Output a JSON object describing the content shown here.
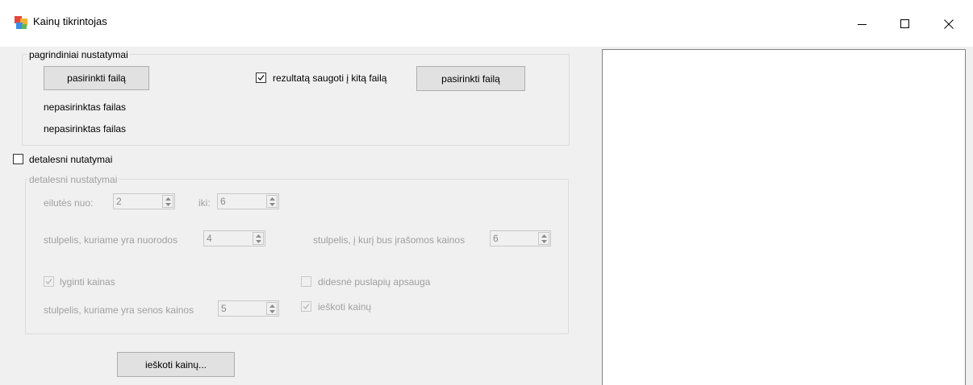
{
  "window": {
    "title": "Kainų tikrintojas",
    "icon": "app-window-icon",
    "controls": [
      "minimize-icon",
      "maximize-icon",
      "close-icon"
    ]
  },
  "main_settings": {
    "group_title": "pagrindiniai nustatymai",
    "choose_file_label": "pasirinkti failą",
    "save_other_checked": true,
    "save_other_label": "rezultatą saugoti į kitą failą",
    "choose_output_file_label": "pasirinkti failą",
    "input_file_status": "nepasirinktas failas",
    "output_file_status": "nepasirinktas failas"
  },
  "detailed_toggle": {
    "checked": false,
    "label": "detalesni nutatymai"
  },
  "detailed": {
    "group_title": "detalesni nustatymai",
    "row_from_label": "eilutės nuo:",
    "row_from_value": "2",
    "row_to_label": "iki:",
    "row_to_value": "6",
    "link_column_label": "stulpelis, kuriame yra nuorodos",
    "link_column_value": "4",
    "write_column_label": "stulpelis, į kurį bus įrašomos kainos",
    "write_column_value": "6",
    "compare_prices_checked": true,
    "compare_prices_label": "lyginti kainas",
    "page_protection_checked": false,
    "page_protection_label": "didesnė puslapių apsauga",
    "old_price_column_label": "stulpelis, kuriame yra senos kainos",
    "old_price_column_value": "5",
    "search_prices_checked": true,
    "search_prices_label": "ieškoti kainų"
  },
  "search_button_label": "ieškoti kainų...",
  "colors": {
    "window_bg": "#f0f0f0",
    "titlebar_bg": "#ffffff",
    "button_bg": "#e1e1e1",
    "disabled_text": "#a0a0a0"
  }
}
